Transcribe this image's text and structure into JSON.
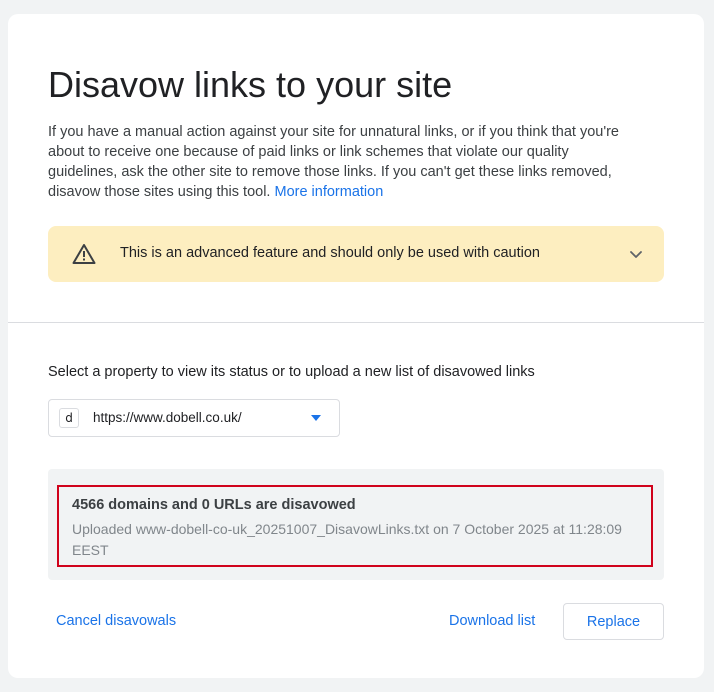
{
  "page": {
    "title": "Disavow links to your site",
    "intro_text": "If you have a manual action against your site for unnatural links, or if you think that you're about to receive one because of paid links or link schemes that violate our quality guidelines, ask the other site to remove those links. If you can't get these links removed, disavow those sites using this tool.",
    "more_info_link": "More information"
  },
  "warning": {
    "text": "This is an advanced feature and should only be used with caution",
    "icon": "warning-triangle-icon"
  },
  "property": {
    "label": "Select a property to view its status or to upload a new list of disavowed links",
    "favicon_letter": "d",
    "selected_url": "https://www.dobell.co.uk/"
  },
  "status": {
    "summary": "4566 domains and 0 URLs are disavowed",
    "details": "Uploaded www-dobell-co-uk_20251007_DisavowLinks.txt on 7 October 2025 at 11:28:09 EEST"
  },
  "actions": {
    "cancel_label": "Cancel disavowals",
    "download_label": "Download list",
    "replace_label": "Replace"
  },
  "colors": {
    "accent": "#1a73e8",
    "warning_bg": "#fdeec0",
    "highlight_border": "#d0021b"
  }
}
